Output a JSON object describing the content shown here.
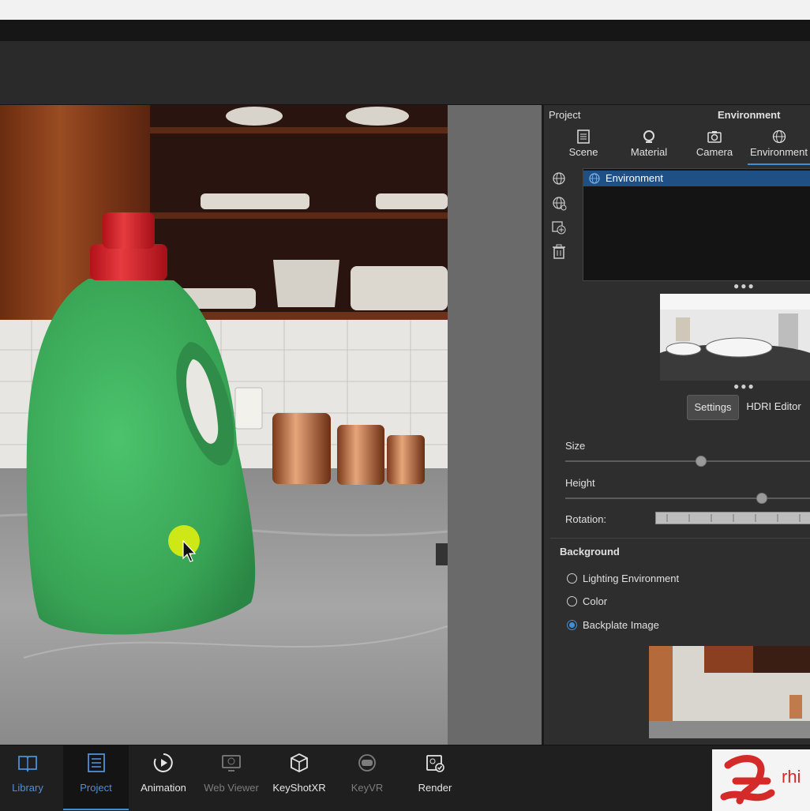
{
  "panel": {
    "project_label": "Project",
    "header_title": "Environment",
    "tabs": [
      {
        "label": "Scene",
        "icon": "scene-list-icon"
      },
      {
        "label": "Material",
        "icon": "material-sphere-icon"
      },
      {
        "label": "Camera",
        "icon": "camera-icon"
      },
      {
        "label": "Environment",
        "icon": "globe-icon",
        "active": true
      }
    ],
    "tree": {
      "item": "Environment",
      "icon": "globe-icon"
    },
    "subtabs": {
      "settings": "Settings",
      "hdri_editor": "HDRI Editor",
      "active": "Settings"
    },
    "size": {
      "label": "Size",
      "value": 0.55
    },
    "height": {
      "label": "Height",
      "value": 0.8
    },
    "rotation": {
      "label": "Rotation:"
    },
    "background": {
      "title": "Background",
      "options": [
        "Lighting Environment",
        "Color",
        "Backplate Image"
      ],
      "selected": "Backplate Image"
    }
  },
  "bottom_bar": {
    "items": [
      {
        "label": "Library",
        "icon": "book-icon",
        "active": false,
        "enabled": true
      },
      {
        "label": "Project",
        "icon": "project-list-icon",
        "active": true,
        "enabled": true
      },
      {
        "label": "Animation",
        "icon": "animation-icon",
        "active": false,
        "enabled": true
      },
      {
        "label": "Web Viewer",
        "icon": "web-viewer-icon",
        "active": false,
        "enabled": false
      },
      {
        "label": "KeyShotXR",
        "icon": "cube-icon",
        "active": false,
        "enabled": true
      },
      {
        "label": "KeyVR",
        "icon": "vr-headset-icon",
        "active": false,
        "enabled": false
      },
      {
        "label": "Render",
        "icon": "render-icon",
        "active": false,
        "enabled": true
      }
    ],
    "logo_text": "rhi"
  },
  "colors": {
    "accent": "#3f8fd6",
    "selection": "#1e4f85",
    "bottle": "#3fae5c",
    "cap": "#d8202a"
  }
}
